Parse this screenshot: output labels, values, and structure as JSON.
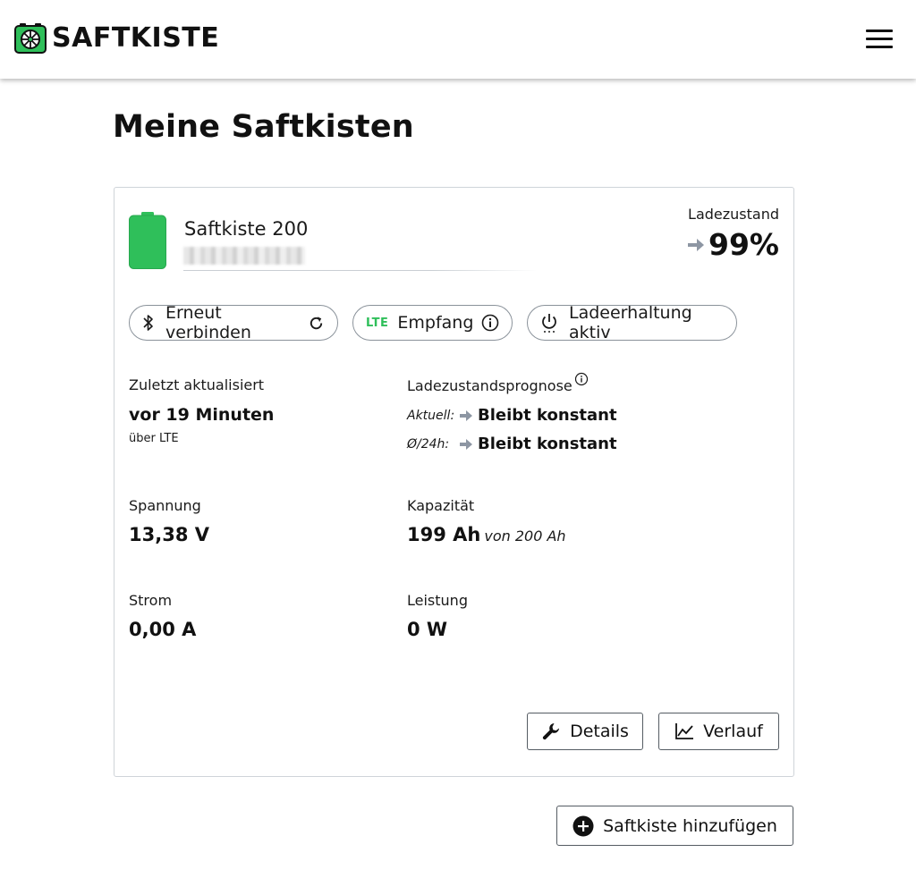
{
  "header": {
    "brand": "SAFTKISTE",
    "logo_icon": "saftkiste-logo-icon",
    "menu_icon": "hamburger-menu-icon"
  },
  "page": {
    "title": "Meine Saftkisten"
  },
  "device": {
    "name": "Saftkiste 200",
    "battery_icon": "battery-full-icon",
    "battery_color": "#2fbf5a",
    "soc_label": "Ladezustand",
    "soc_value": "99%",
    "soc_trend_icon": "arrow-right-icon",
    "pills": {
      "reconnect": {
        "label": "Erneut verbinden",
        "icon": "bluetooth-icon",
        "action_icon": "refresh-icon"
      },
      "reception": {
        "badge": "LTE",
        "label": "Empfang",
        "action_icon": "info-icon"
      },
      "charge": {
        "label": "Ladeerhaltung aktiv",
        "icon": "power-icon"
      }
    },
    "last_updated": {
      "label": "Zuletzt aktualisiert",
      "value": "vor 19 Minuten",
      "via": "über LTE"
    },
    "forecast": {
      "label": "Ladezustandsprognose",
      "current_key": "Aktuell:",
      "current_value": "Bleibt konstant",
      "avg_key": "Ø/24h:",
      "avg_value": "Bleibt konstant"
    },
    "voltage": {
      "label": "Spannung",
      "value": "13,38 V"
    },
    "capacity": {
      "label": "Kapazität",
      "value": "199 Ah",
      "of": "von 200 Ah"
    },
    "current": {
      "label": "Strom",
      "value": "0,00 A"
    },
    "power": {
      "label": "Leistung",
      "value": "0 W"
    },
    "buttons": {
      "details": {
        "label": "Details",
        "icon": "wrench-icon"
      },
      "history": {
        "label": "Verlauf",
        "icon": "line-chart-icon"
      }
    }
  },
  "add_button": {
    "label": "Saftkiste hinzufügen",
    "icon": "plus-circle-icon"
  },
  "colors": {
    "accent": "#2fbf5a",
    "arrow": "#8d96a3",
    "text": "#111111",
    "border": "#cfd4d9"
  }
}
